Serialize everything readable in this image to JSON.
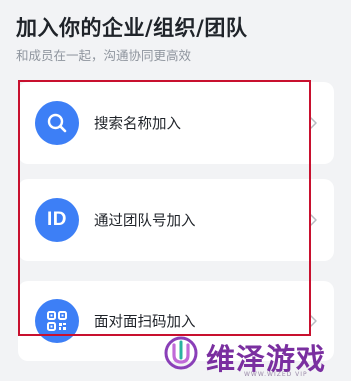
{
  "header": {
    "title": "加入你的企业/组织/团队",
    "subtitle": "和成员在一起，沟通协同更高效"
  },
  "options": [
    {
      "label": "搜索名称加入",
      "icon": "search-icon"
    },
    {
      "label": "通过团队号加入",
      "icon": "id-icon",
      "icon_text": "ID"
    },
    {
      "label": "面对面扫码加入",
      "icon": "qr-code-icon"
    }
  ],
  "watermark": {
    "name": "维泽游戏",
    "tagline": "WWW.WIZED VIP"
  },
  "colors": {
    "accent": "#3d7ff6",
    "highlight": "#c8102e",
    "watermark": "#7a2fa0"
  }
}
